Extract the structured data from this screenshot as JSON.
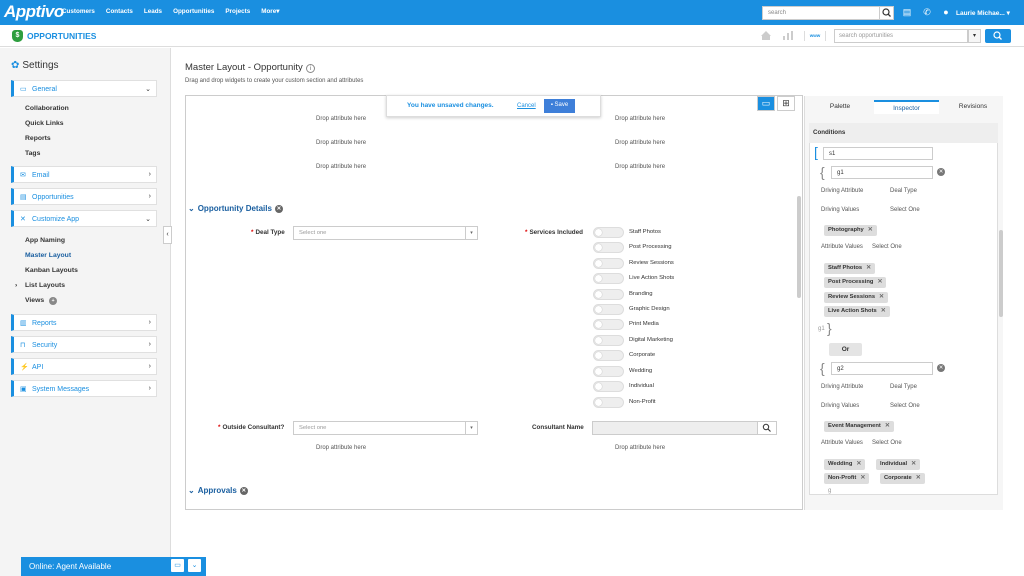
{
  "topbar": {
    "logo": "Apptivo",
    "nav": [
      "Customers",
      "Contacts",
      "Leads",
      "Opportunities",
      "Projects",
      "More"
    ],
    "search_placeholder": "search",
    "user": "Laurie Michae..."
  },
  "subbar": {
    "app_title": "OPPORTUNITIES",
    "search_placeholder": "search opportunities"
  },
  "sidebar": {
    "title": "Settings",
    "general": "General",
    "general_items": [
      "Collaboration",
      "Quick Links",
      "Reports",
      "Tags"
    ],
    "email": "Email",
    "opportunities": "Opportunities",
    "customize": "Customize App",
    "customize_items": [
      "App Naming",
      "Master Layout",
      "Kanban Layouts",
      "List Layouts",
      "Views"
    ],
    "reports": "Reports",
    "security": "Security",
    "api": "API",
    "system_messages": "System Messages"
  },
  "chat": {
    "status": "Online: Agent Available"
  },
  "main": {
    "title": "Master Layout - Opportunity",
    "subtitle": "Drag and drop widgets to create your custom section and attributes",
    "unsaved": "You have unsaved changes.",
    "cancel": "Cancel",
    "save": "Save",
    "drop_text": "Drop attribute here",
    "section1": "Opportunity Details",
    "deal_type_label": "Deal Type",
    "select_placeholder": "Select one",
    "services_label": "Services Included",
    "services": [
      "Staff Photos",
      "Post Processing",
      "Review Sessions",
      "Live Action Shots",
      "Branding",
      "Graphic Design",
      "Print Media",
      "Digital Marketing",
      "Corporate",
      "Wedding",
      "Individual",
      "Non-Profit"
    ],
    "outside_label": "Outside Consultant?",
    "consultant_label": "Consultant Name",
    "section2": "Approvals"
  },
  "panel": {
    "tabs": [
      "Palette",
      "Inspector",
      "Revisions"
    ],
    "conditions": "Conditions",
    "s1": "s1",
    "g1": "g1",
    "g2": "g2",
    "driving_attribute": "Driving Attribute",
    "deal_type": "Deal Type",
    "driving_values": "Driving Values",
    "select_one": "Select One",
    "attribute_values": "Attribute Values",
    "g1_driving_chip": "Photography",
    "g1_attr_chips": [
      "Staff Photos",
      "Post Processing",
      "Review Sessions",
      "Live Action Shots"
    ],
    "g1_close_label": "g1",
    "or": "Or",
    "g2_driving_chip": "Event Management",
    "g2_attr_chips": [
      "Wedding",
      "Individual",
      "Non-Profit",
      "Corporate"
    ],
    "tail": "g"
  }
}
